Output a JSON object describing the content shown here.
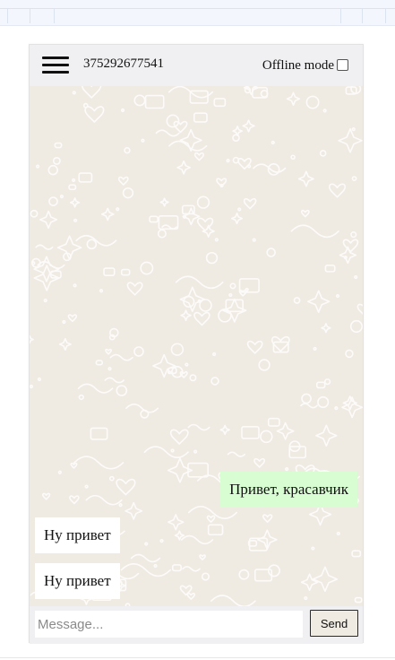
{
  "header": {
    "phone_number": "375292677541",
    "offline_label": "Offline mode",
    "offline_checked": false
  },
  "messages": [
    {
      "direction": "out",
      "text": "Привет, красавчик"
    },
    {
      "direction": "in",
      "text": "Ну привет"
    },
    {
      "direction": "in",
      "text": "Ну привет"
    }
  ],
  "composer": {
    "placeholder": "Message...",
    "value": "",
    "send_label": "Send"
  },
  "icons": {
    "menu": "hamburger-menu-icon",
    "checkbox": "checkbox-unchecked"
  },
  "colors": {
    "chat_bg": "#efeae2",
    "outgoing_bubble": "#d9fdd3",
    "incoming_bubble": "#ffffff",
    "header_bg": "#f0f0f2"
  }
}
